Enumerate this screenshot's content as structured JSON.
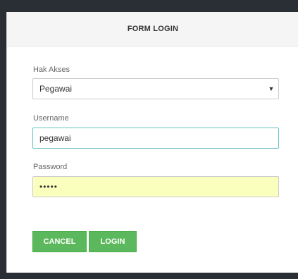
{
  "form": {
    "title": "FORM LOGIN",
    "hak_akses": {
      "label": "Hak Akses",
      "selected": "Pegawai",
      "arrow": "▼"
    },
    "username": {
      "label": "Username",
      "value": "pegawai"
    },
    "password": {
      "label": "Password",
      "masked_value": "•••••"
    },
    "buttons": {
      "cancel": "CANCEL",
      "login": "LOGIN"
    }
  },
  "colors": {
    "button": "#5cb85c",
    "focus_border": "#66c2c6",
    "autofill_bg": "#faffbd",
    "backdrop": "#2a2f36"
  },
  "icons": {
    "select_arrow": "chevron-down-icon"
  }
}
